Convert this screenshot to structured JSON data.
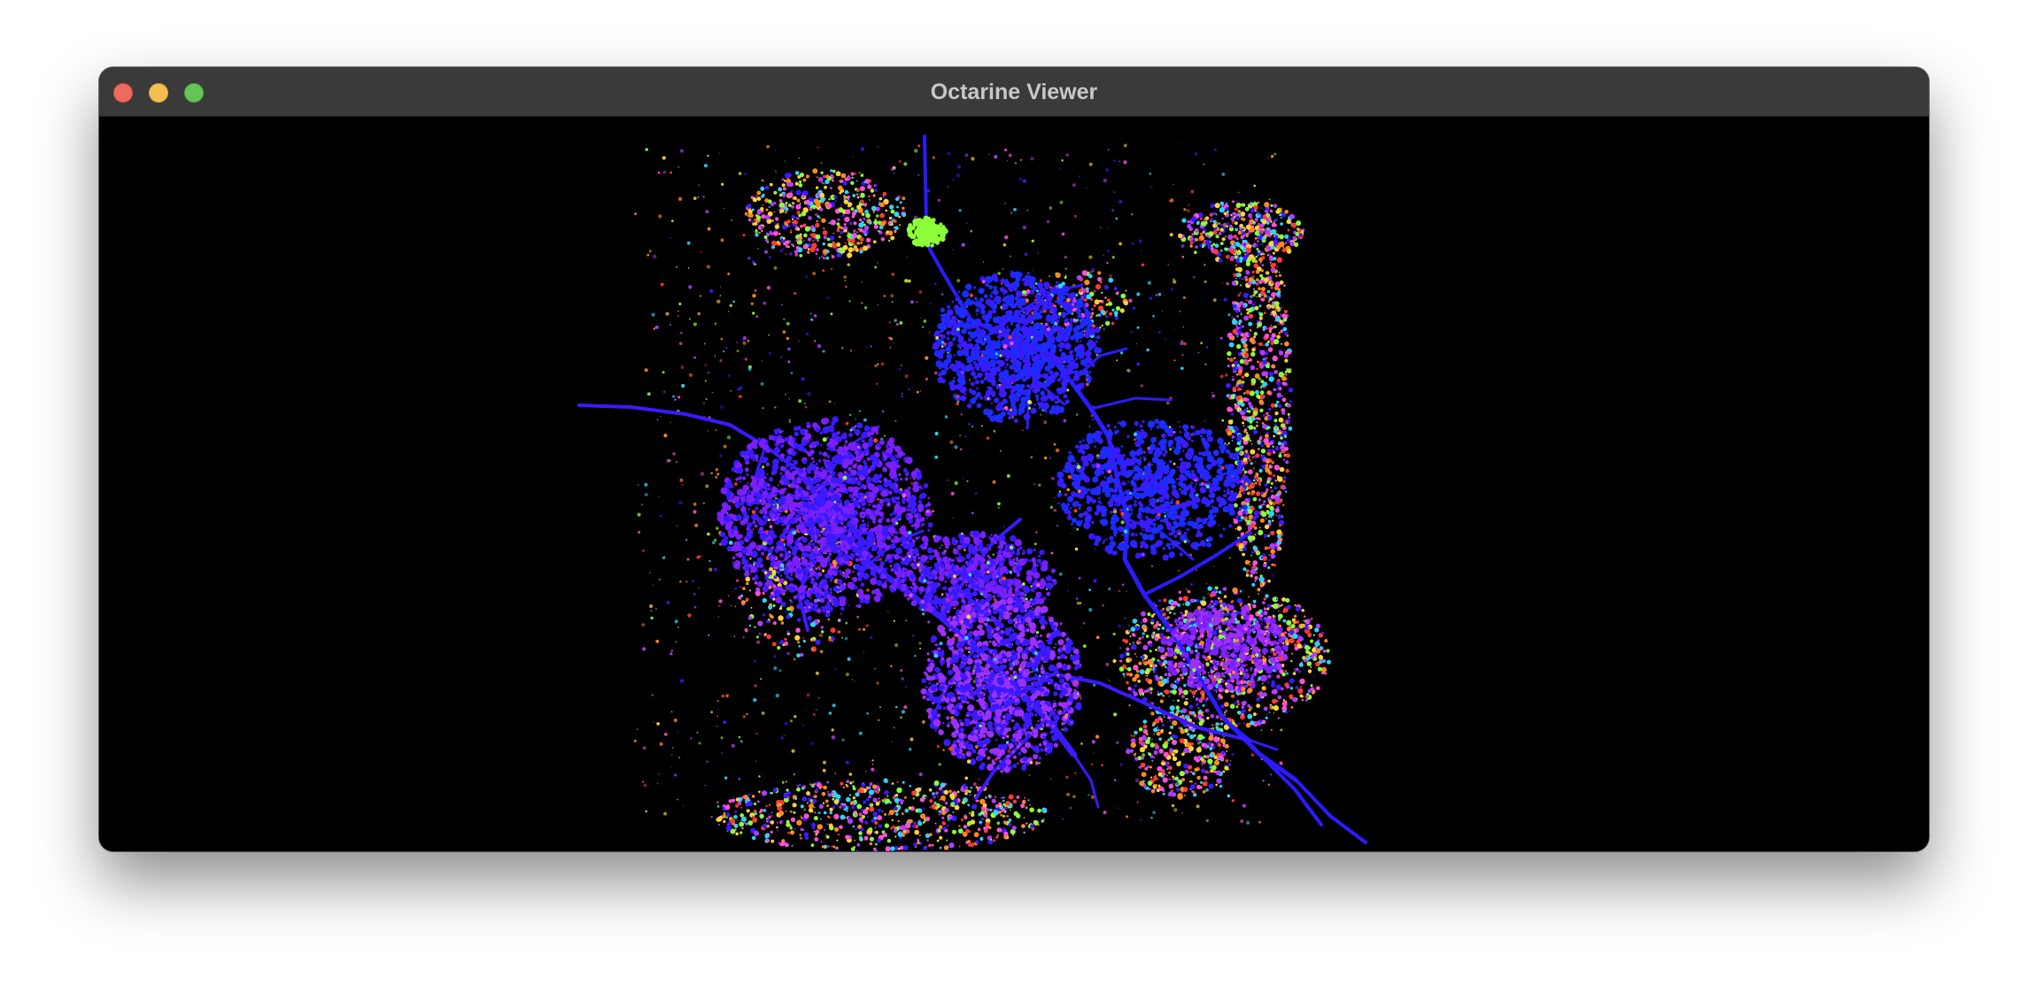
{
  "window": {
    "title": "Octarine Viewer"
  },
  "titlebar": {
    "buttons": [
      {
        "name": "close",
        "color": "#ed6a5e"
      },
      {
        "name": "minimize",
        "color": "#f5bf4f"
      },
      {
        "name": "zoom",
        "color": "#62c554"
      }
    ]
  },
  "viewer": {
    "background": "#000000",
    "neuron_colors": [
      "#3a1aff",
      "#1a2cff",
      "#7a1fff",
      "#9b30ff"
    ],
    "speckle_colors": [
      "#ff3b2f",
      "#ffd43b",
      "#8cff3a",
      "#b23cff",
      "#ff8a1f",
      "#2bd4ff",
      "#ff4fd8",
      "#3a1aff"
    ],
    "highlight_soma_color": "#8cff3a"
  }
}
